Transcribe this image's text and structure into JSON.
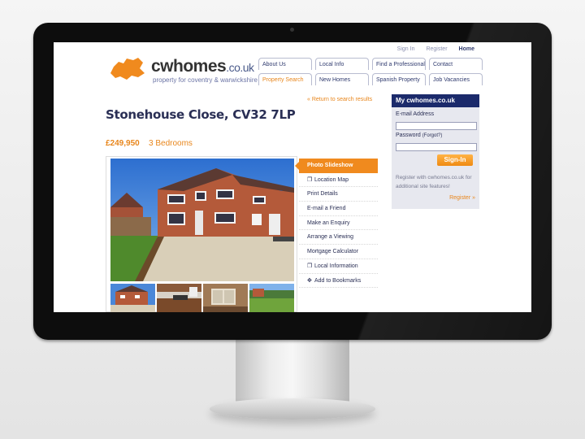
{
  "site": {
    "logo_text": "cwhomes",
    "logo_domain": ".co.uk",
    "tagline": "property for coventry & warwickshire"
  },
  "toplinks": [
    "Sign In",
    "Register",
    "Home"
  ],
  "nav": {
    "row1": [
      "About Us",
      "Local Info",
      "Find a Professional",
      "Contact"
    ],
    "row2": [
      "Property Search",
      "New Homes",
      "Spanish Property",
      "Job Vacancies"
    ],
    "active": "Property Search"
  },
  "listing": {
    "title": "Stonehouse Close, CV32 7LP",
    "return_link": "« Return to search results",
    "price": "£249,950",
    "bedrooms": "3 Bedrooms"
  },
  "menu": [
    {
      "label": "Photo Slideshow",
      "icon": "",
      "active": true
    },
    {
      "label": "Location Map",
      "icon": "window-icon"
    },
    {
      "label": "Print Details",
      "icon": ""
    },
    {
      "label": "E-mail a Friend",
      "icon": ""
    },
    {
      "label": "Make an Enquiry",
      "icon": ""
    },
    {
      "label": "Arrange a Viewing",
      "icon": ""
    },
    {
      "label": "Mortgage Calculator",
      "icon": ""
    },
    {
      "label": "Local Information",
      "icon": "window-icon"
    },
    {
      "label": "Add to Bookmarks",
      "icon": "star-icon"
    }
  ],
  "login_panel": {
    "heading": "My cwhomes.co.uk",
    "email_label": "E-mail Address",
    "password_label": "Password",
    "forgot_label": "(Forgot?)",
    "signin_label": "Sign-In",
    "note": "Register with cwhomes.co.uk for additional site features!",
    "register_link": "Register »"
  },
  "colors": {
    "accent": "#e8861c",
    "navy": "#1b2a6b"
  }
}
